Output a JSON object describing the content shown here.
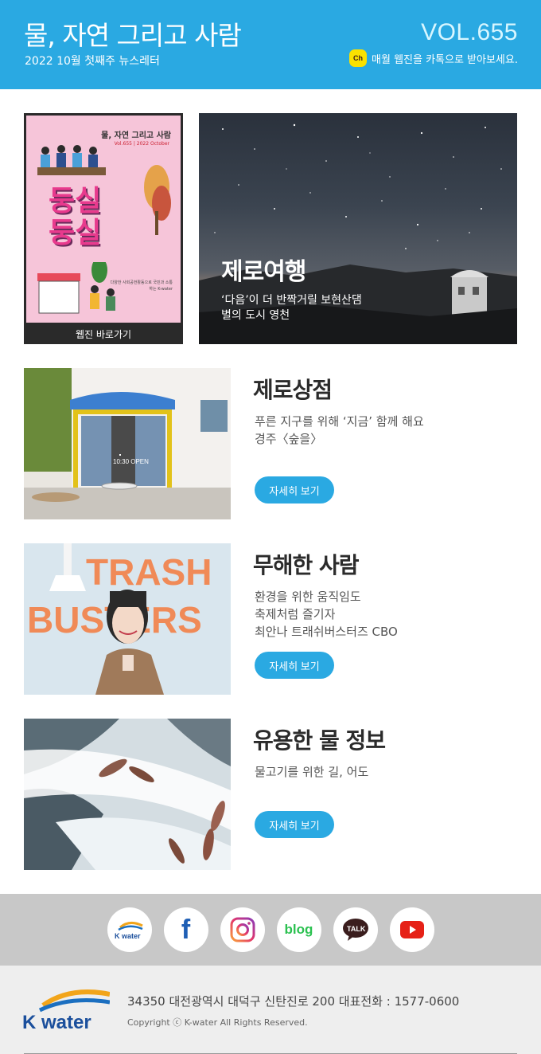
{
  "header": {
    "title": "물, 자연 그리고 사람",
    "subtitle": "2022 10월 첫째주 뉴스레터",
    "volume": "VOL.655",
    "kakao_badge": "Ch",
    "kakao_text": "매월 웹진을 카톡으로 받아보세요."
  },
  "webzine": {
    "cover_title": "물, 자연 그리고 사람",
    "cover_vol": "Vol.655 | 2022 October",
    "cover_headline_1": "둥실",
    "cover_headline_2": "둥실",
    "cover_text": "다양한 사회공헌활동으로 국민과 소통하는 K-water",
    "link_label": "웹진 바로가기"
  },
  "hero": {
    "title": "제로여행",
    "desc_line1": "‘다음’이 더 반짝거릴 보현산댐",
    "desc_line2": "별의 도시 영천"
  },
  "articles": [
    {
      "title": "제로상점",
      "lines": [
        "푸른 지구를 위해 ‘지금’ 함께 해요",
        "경주〈숲을〉"
      ],
      "button": "자세히 보기",
      "sign": "10:30 OPEN"
    },
    {
      "title": "무해한 사람",
      "lines": [
        "환경을 위한 움직임도",
        "축제처럼 즐기자",
        "최안나 트래쉬버스터즈 CBO"
      ],
      "button": "자세히 보기",
      "wall_line1": "TRASH",
      "wall_line2": "BUSTERS"
    },
    {
      "title": "유용한 물 정보",
      "lines": [
        "물고기를 위한 길, 어도"
      ],
      "button": "자세히 보기"
    }
  ],
  "social": {
    "kwater": "K water",
    "facebook": "f",
    "blog": "blog",
    "talk": "TALK",
    "icons": [
      "kwater-icon",
      "facebook-icon",
      "instagram-icon",
      "blog-icon",
      "kakaotalk-icon",
      "youtube-icon"
    ]
  },
  "footer": {
    "logo_text": "K water",
    "address": "34350 대전광역시 대덕구 신탄진로 200   대표전화 : 1577-0600",
    "copyright": "Copyright ⓒ K-water All Rights Reserved."
  },
  "colors": {
    "brand_blue": "#2aa9e2",
    "kakao_yellow": "#fae100",
    "footer_bg": "#eeeeee",
    "social_bg": "#c8c8c8"
  }
}
